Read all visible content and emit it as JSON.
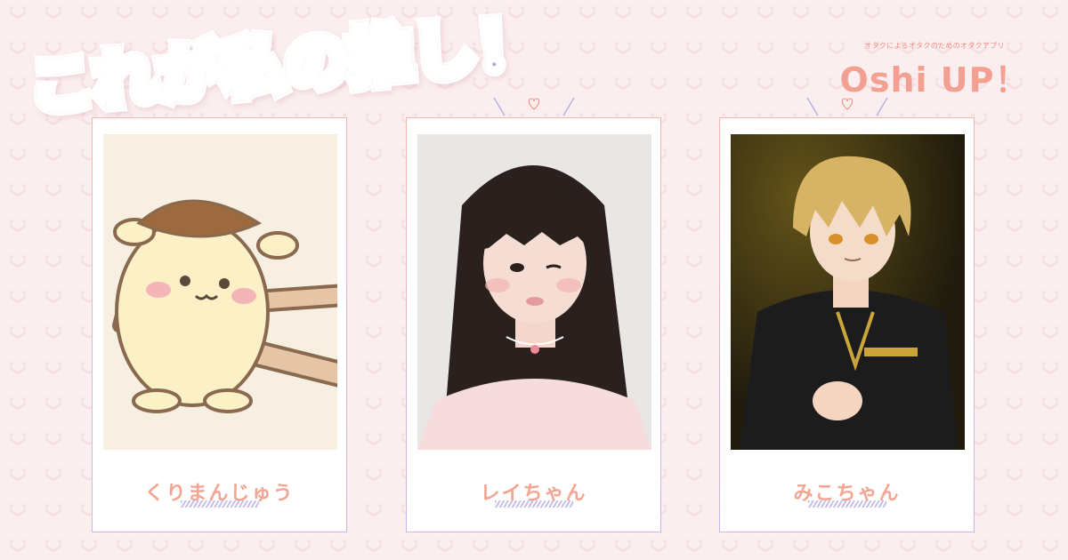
{
  "headline": "これが私の推し！",
  "logo": {
    "tagline": "オタクによるオタクのためのオタクアプリ",
    "name": "Oshi UP！"
  },
  "colors": {
    "background": "#fbeeef",
    "accent_pink": "#f3a093",
    "accent_lavender": "#c5c0ea"
  },
  "cards": [
    {
      "name": "くりまんじゅう",
      "image": "cartoon-character-photo"
    },
    {
      "name": "レイちゃん",
      "image": "girl-portrait-photo"
    },
    {
      "name": "みこちゃん",
      "image": "anime-character-photo"
    }
  ]
}
